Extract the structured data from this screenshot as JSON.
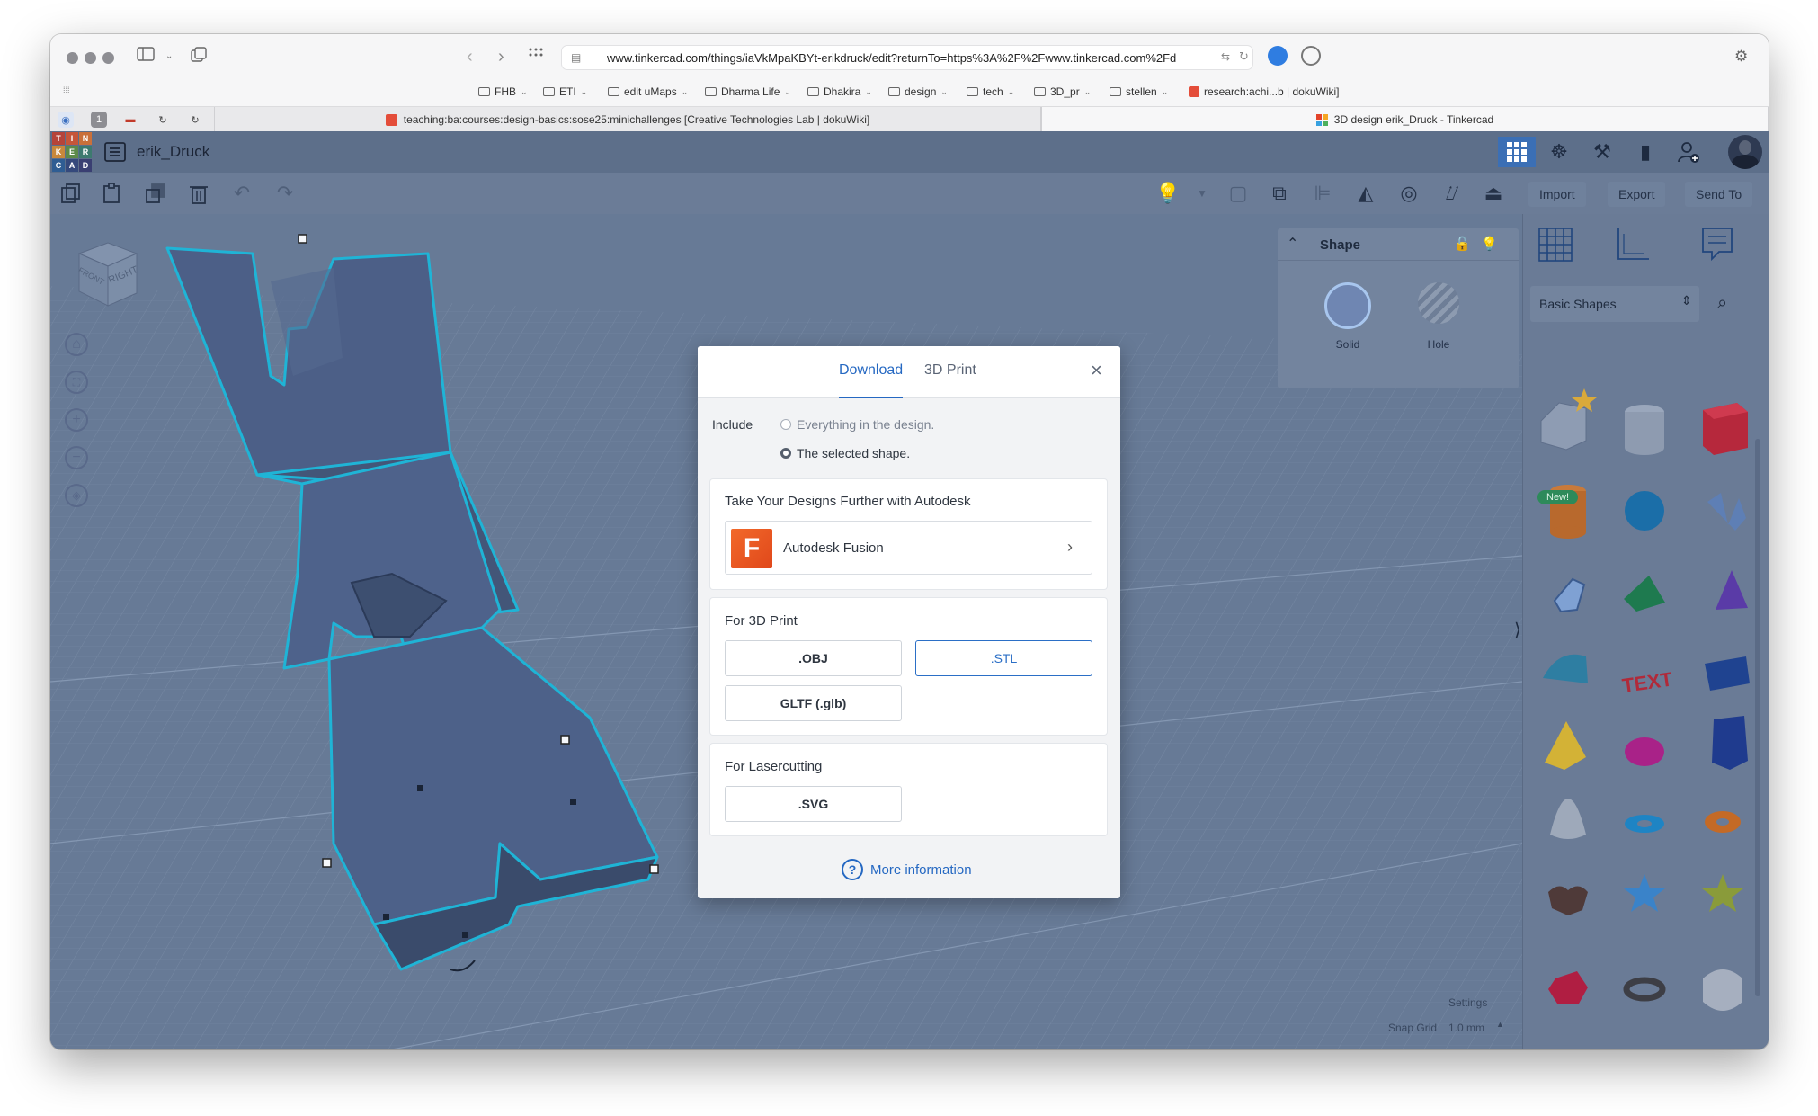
{
  "browser": {
    "url": "www.tinkercad.com/things/iaVkMpaKBYt-erikdruck/edit?returnTo=https%3A%2F%2Fwww.tinkercad.com%2Fd",
    "bookmarks": [
      "FHB",
      "ETI",
      "edit uMaps",
      "Dharma Life",
      "Dhakira",
      "design",
      "tech",
      "3D_pr",
      "stellen",
      "research:achi...b | dokuWiki]"
    ],
    "tabs": {
      "pinned_count": "1",
      "tab1_title": "teaching:ba:courses:design-basics:sose25:minichallenges [Creative Technologies Lab | dokuWiki]",
      "tab2_title": "3D design erik_Druck - Tinkercad"
    }
  },
  "app": {
    "logo_letters": [
      "T",
      "I",
      "N",
      "K",
      "E",
      "R",
      "C",
      "A",
      "D"
    ],
    "design_title": "erik_Druck",
    "top_buttons": {
      "import": "Import",
      "export": "Export",
      "send_to": "Send To"
    },
    "shape_panel": {
      "title": "Shape",
      "solid": "Solid",
      "hole": "Hole"
    },
    "library": {
      "category": "Basic Shapes",
      "new_badge": "New!"
    },
    "viewcube": {
      "front": "FRONT",
      "right": "RIGHT"
    },
    "status": {
      "settings": "Settings",
      "snap_label": "Snap Grid",
      "snap_value": "1.0 mm"
    }
  },
  "dialog": {
    "tabs": {
      "download": "Download",
      "print": "3D Print"
    },
    "close": "×",
    "include_label": "Include",
    "options": {
      "everything": "Everything in the design.",
      "selected": "The selected shape."
    },
    "autodesk": {
      "heading": "Take Your Designs Further with Autodesk",
      "fusion": "Autodesk Fusion",
      "logo_letter": "F"
    },
    "print_section": {
      "heading": "For 3D Print",
      "obj": ".OBJ",
      "stl": ".STL",
      "gltf": "GLTF (.glb)"
    },
    "laser_section": {
      "heading": "For Lasercutting",
      "svg": ".SVG"
    },
    "more_info": "More information"
  },
  "colors": {
    "accent": "#2568c2",
    "workplane": "#6b7d98",
    "model": "#4a5f86",
    "selection_outline": "#1fb4d6",
    "fusion_orange": "#e8561f"
  }
}
